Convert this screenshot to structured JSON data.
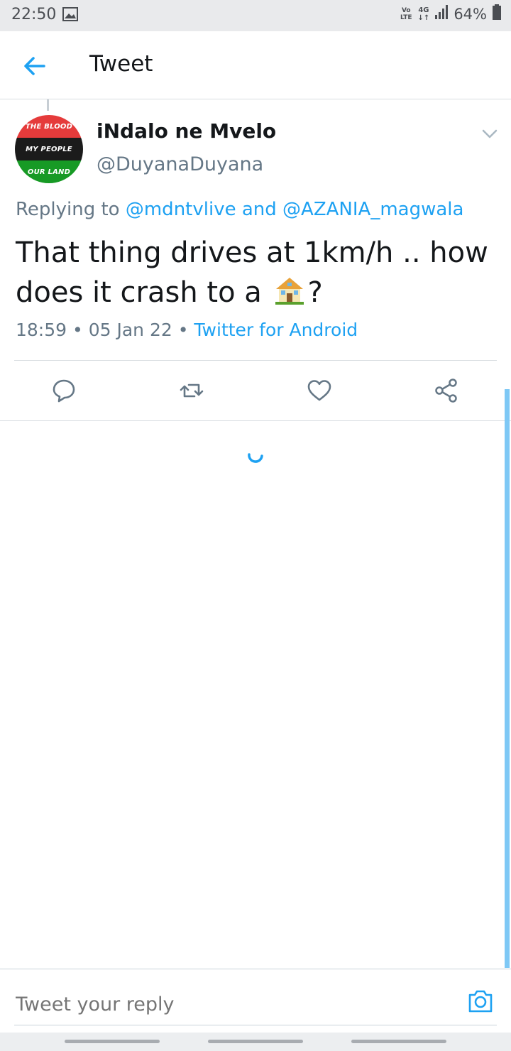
{
  "status_bar": {
    "time": "22:50",
    "volte": "Vo\nLTE",
    "network": "4G",
    "battery": "64%"
  },
  "header": {
    "title": "Tweet"
  },
  "tweet": {
    "avatar_lines": [
      "THE BLOOD",
      "MY PEOPLE",
      "OUR LAND"
    ],
    "display_name": "iNdalo ne Mvelo",
    "handle": "@DuyanaDuyana",
    "replying_prefix": "Replying to",
    "reply_mention_1": "@mdntvlive",
    "reply_and": "and",
    "reply_mention_2": "@AZANIA_magwala",
    "text_before_emoji": "That thing drives at 1km/h .. how does it crash to a",
    "emoji_icon": "house-emoji",
    "text_after_emoji": "?",
    "time": "18:59",
    "separator": "•",
    "date": "05 Jan 22",
    "source": "Twitter for Android"
  },
  "actions": {
    "reply_icon": "speech-bubble-icon",
    "retweet_icon": "retweet-icon",
    "like_icon": "heart-icon",
    "share_icon": "share-icon"
  },
  "composer": {
    "placeholder": "Tweet your reply",
    "camera_icon": "camera-icon"
  },
  "colors": {
    "accent": "#1da1f2",
    "secondary_text": "#657786",
    "status_bar_bg": "#e9eaec"
  }
}
